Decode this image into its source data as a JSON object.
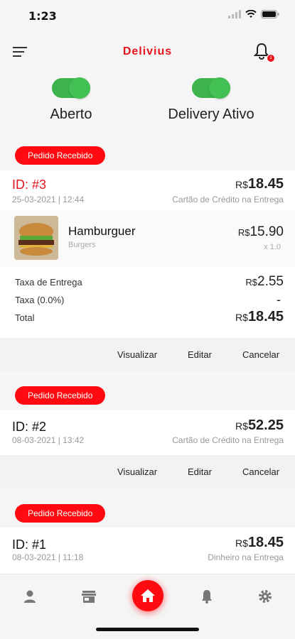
{
  "status": {
    "time": "1:23"
  },
  "header": {
    "title": "Delivius",
    "bell_badge": "1"
  },
  "toggles": [
    {
      "label": "Aberto"
    },
    {
      "label": "Delivery Ativo"
    }
  ],
  "orders": [
    {
      "status": "Pedido Recebido",
      "id": "ID: #3",
      "date": "25-03-2021 | 12:44",
      "currency": "R$",
      "total": "18.45",
      "payment": "Cartão de Crédito na Entrega",
      "item": {
        "name": "Hamburguer",
        "category": "Burgers",
        "currency": "R$",
        "price": "15.90",
        "qty": "x 1.0"
      },
      "summary": {
        "delivery_label": "Taxa de Entrega",
        "delivery_currency": "R$",
        "delivery_value": "2.55",
        "tax_label": "Taxa (0.0%)",
        "tax_value": "-",
        "total_label": "Total",
        "total_currency": "R$",
        "total_value": "18.45"
      }
    },
    {
      "status": "Pedido Recebido",
      "id": "ID: #2",
      "date": "08-03-2021 | 13:42",
      "currency": "R$",
      "total": "52.25",
      "payment": "Cartão de Crédito na Entrega"
    },
    {
      "status": "Pedido Recebido",
      "id": "ID: #1",
      "date": "08-03-2021 | 11:18",
      "currency": "R$",
      "total": "18.45",
      "payment": "Dinheiro na Entrega"
    }
  ],
  "actions": {
    "view": "Visualizar",
    "edit": "Editar",
    "cancel": "Cancelar"
  },
  "tabbar": {
    "icons": [
      "user-icon",
      "store-icon",
      "home-icon",
      "bell-icon",
      "gear-icon"
    ]
  },
  "colors": {
    "brand": "#e8141b",
    "toggle_on": "#43c053"
  }
}
